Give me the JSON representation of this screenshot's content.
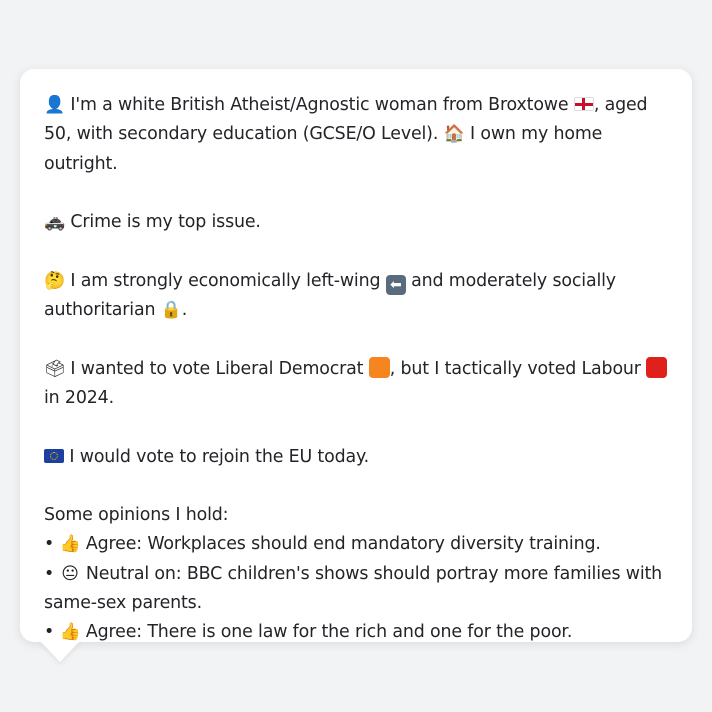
{
  "profile": {
    "identity_icon": "👤",
    "identity_text": "I'm a white British Atheist/Agnostic woman from Broxtowe",
    "region_flag": "england-flag",
    "identity_text_2": ", aged 50, with secondary education (GCSE/O Level).",
    "home_icon": "🏠",
    "home_text": "I own my home outright.",
    "crime_icon": "🚓",
    "crime_text": "Crime is my top issue.",
    "politics_icon": "🤔",
    "politics_text_1": "I am strongly economically left-wing",
    "left_icon": "⬅",
    "politics_text_2": "and moderately socially authoritarian",
    "lock_icon": "🔒",
    "politics_text_3": ".",
    "vote_icon": "🗳",
    "vote_text_1": "I wanted to vote Liberal Democrat",
    "vote_text_2": ", but I tactically voted Labour",
    "vote_text_3": "in 2024.",
    "eu_flag": "eu-flag",
    "eu_text": "I would vote to rejoin the EU today."
  },
  "colors": {
    "lib_dem": "#f6851f",
    "labour": "#e0201b"
  },
  "opinions": {
    "heading": "Some opinions I hold:",
    "items": [
      {
        "bullet": "•",
        "icon": "👍",
        "text": "Agree: Workplaces should end mandatory diversity training."
      },
      {
        "bullet": "•",
        "icon": "😐",
        "text": "Neutral on: BBC children's shows should portray more families with same-sex parents."
      },
      {
        "bullet": "•",
        "icon": "👍",
        "text": "Agree: There is one law for the rich and one for the poor."
      }
    ]
  }
}
